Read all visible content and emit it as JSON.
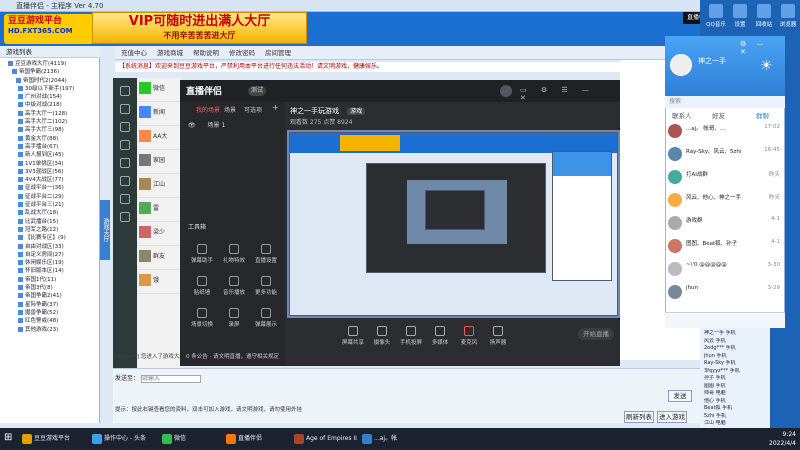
{
  "window": {
    "title": "直播伴侣 - 主程序 Ver 4.70"
  },
  "banner": {
    "logo_line1": "豆豆游戏平台",
    "logo_line2": "HD.FXT365.COM",
    "vip_line1": "VIP可随时进出满人大厅",
    "vip_line2": "不用辛苦苦苦进大厅"
  },
  "toolbar": {
    "items": [
      "充值中心",
      "游戏商城",
      "帮助说明",
      "修改密码",
      "房间管理"
    ]
  },
  "announcement": "【系统消息】欢迎来到豆豆游戏平台，严禁利用本平台进行任何违法活动！请文明游戏，健康娱乐。",
  "left_tree": {
    "header": "游戏列表",
    "rows": [
      "豆豆游戏大厅(4119)",
      "帝国争霸(2136)",
      "帝国时代2(2044)",
      "30级以下新手(197)",
      "广州对战(154)",
      "中级对战(218)",
      "高手大厅一(128)",
      "高手大厅二(102)",
      "高手大厅三(98)",
      "黄金大厅(88)",
      "高手擂台(67)",
      "新人报到区(45)",
      "1V1单挑区(34)",
      "3V3混战区(56)",
      "4V4大战区(77)",
      "征战平台一(36)",
      "征战平台二(29)",
      "征战平台三(21)",
      "乱战大厅(18)",
      "比武擂台(15)",
      "冠军之路(12)",
      "【比赛专区】(9)",
      "自由对战区(33)",
      "自定义房间(27)",
      "休闲娱乐区(19)",
      "怀旧版本区(14)",
      "帝国1代(11)",
      "帝国3代(8)",
      "帝国争霸2(41)",
      "星际争霸(37)",
      "魔兽争霸(52)",
      "红色警戒(48)",
      "其他游戏(23)"
    ]
  },
  "side_tab": "游戏大厅",
  "chat_list": [
    {
      "name": "微信"
    },
    {
      "name": "新闻"
    },
    {
      "name": "AA大"
    },
    {
      "name": "家园"
    },
    {
      "name": "江山"
    },
    {
      "name": "雷"
    },
    {
      "name": "梁少"
    },
    {
      "name": "群友"
    },
    {
      "name": "饿"
    }
  ],
  "room_notice": "[system] 您进入了游戏大厅",
  "message_bar": {
    "label": "发送至：",
    "placeholder": "请输入"
  },
  "bottom_tip": "提示：按此右键查看您的资料，双击可加入游戏，请文明游戏，请勿使用外挂",
  "bottom_buttons": {
    "refresh": "刷新列表",
    "start": "进入游戏",
    "send": "发送"
  },
  "overlay": {
    "app_name": "直播伴侣",
    "tag": "测试",
    "tabs": [
      "我的场景",
      "场景",
      "可选项"
    ],
    "scene_label": "场景 1",
    "tools_label": "工具箱",
    "tools": [
      {
        "name": "弹幕助手"
      },
      {
        "name": "礼物特效"
      },
      {
        "name": "直播设置"
      },
      {
        "name": "贴纸墙"
      },
      {
        "name": "音乐播放"
      },
      {
        "name": "更多功能"
      },
      {
        "name": "场景切换"
      },
      {
        "name": "录屏"
      },
      {
        "name": "弹幕展示"
      }
    ],
    "chat_line": "0 条公告 · 请文明直播，遵守相关规定",
    "stream_name": "神之一手玩游戏",
    "stream_tag": "游戏",
    "stream_stats": "观看数 275   点赞 8924",
    "controls": [
      {
        "name": "屏幕共享"
      },
      {
        "name": "摄像头"
      },
      {
        "name": "手机投屏"
      },
      {
        "name": "多媒体"
      },
      {
        "name": "麦克风"
      },
      {
        "name": "扬声器"
      }
    ],
    "start_button": "开始直播"
  },
  "notification": "直播中：帅哥",
  "qq": {
    "name": "神之一手",
    "search_placeholder": "搜索",
    "tabs": [
      "联系人",
      "好友",
      "群聊"
    ],
    "conversations": [
      {
        "name": "...aj。 帐哥、...",
        "time": "17:02"
      },
      {
        "name": "Ray-Sky、风云、5zhi",
        "time": "16:45"
      },
      {
        "name": "打AI战群",
        "time": "昨天"
      },
      {
        "name": "风云、他心、神之一手",
        "time": "昨天"
      },
      {
        "name": "游戏群",
        "time": "4-1"
      },
      {
        "name": "图图、Beat狐、孙子",
        "time": "4-1"
      },
      {
        "name": "~\\'0 @@@@@",
        "time": "3-30"
      },
      {
        "name": "jhun",
        "time": "3-29"
      }
    ]
  },
  "right_list": [
    "神之一手 手机",
    "风云 手机",
    "2odg*** 手机",
    "jhun 手机",
    "Ray-Sky 手机",
    "3fqyyz*** 手机",
    "孙子 手机",
    "图图 手机",
    "帅哥 电脑",
    "他心 手机",
    "Beat狐 手机",
    "5zhi 手机",
    "江山 电脑"
  ],
  "taskbar": {
    "items": [
      {
        "label": "豆豆游戏平台",
        "color": "#e0a000"
      },
      {
        "label": "操作中心 - 头条",
        "color": "#3aa0f0"
      },
      {
        "label": "微信",
        "color": "#2cbf4a"
      },
      {
        "label": "直播伴侣",
        "color": "#ff7700"
      },
      {
        "label": "Age of Empires II",
        "color": "#aa4422"
      },
      {
        "label": "...aj。帐",
        "color": "#2f7fd6"
      }
    ],
    "time": "9:24",
    "date": "2022/4/4"
  },
  "desktop_icons": [
    "QQ音乐",
    "设置",
    "回收站",
    "浏览器"
  ]
}
